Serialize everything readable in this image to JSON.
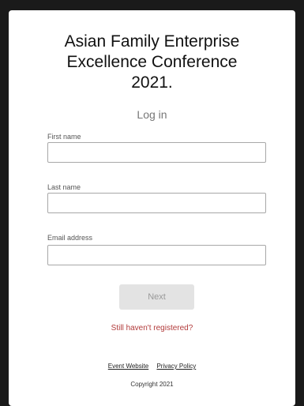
{
  "header": {
    "title_lines": [
      "Asian Family Enterprise",
      "Excellence Conference",
      "2021."
    ],
    "subtitle": "Log in"
  },
  "form": {
    "first_name": {
      "label": "First name",
      "value": ""
    },
    "last_name": {
      "label": "Last name",
      "value": ""
    },
    "email": {
      "label": "Email address",
      "value": ""
    },
    "next_label": "Next",
    "register_link": "Still haven't registered?"
  },
  "footer": {
    "event_website": "Event Website",
    "privacy_policy": "Privacy Policy",
    "copyright": "Copyright 2021"
  },
  "colors": {
    "background": "#1a1a1a",
    "card": "#ffffff",
    "link_red": "#b23b3b",
    "button_disabled": "#e3e3e3"
  }
}
